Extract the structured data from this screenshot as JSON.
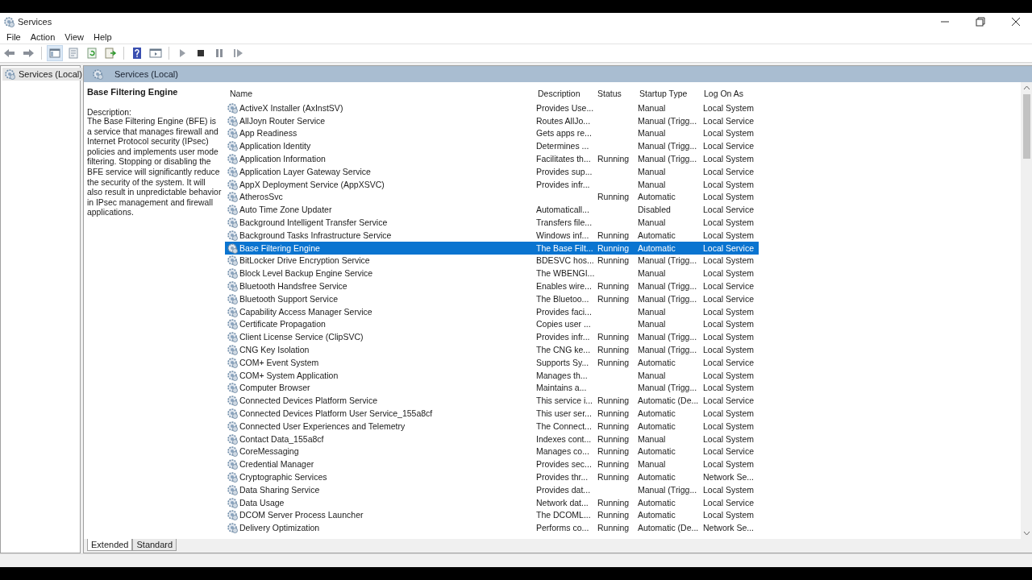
{
  "window": {
    "title": "Services"
  },
  "menu": [
    "File",
    "Action",
    "View",
    "Help"
  ],
  "toolbar": [
    {
      "kind": "back"
    },
    {
      "kind": "forward"
    },
    {
      "kind": "sep"
    },
    {
      "kind": "tree",
      "selected": true
    },
    {
      "kind": "props",
      "selected": false
    },
    {
      "kind": "refresh",
      "selected": false
    },
    {
      "kind": "export",
      "selected": false
    },
    {
      "kind": "sep"
    },
    {
      "kind": "help",
      "selected": false
    },
    {
      "kind": "view",
      "selected": false
    },
    {
      "kind": "sep"
    },
    {
      "kind": "play"
    },
    {
      "kind": "stop"
    },
    {
      "kind": "pause"
    },
    {
      "kind": "resume"
    }
  ],
  "tree": {
    "items": [
      {
        "label": "Services (Local)",
        "selected": true
      }
    ]
  },
  "panel": {
    "title": "Services (Local)"
  },
  "details": {
    "title": "Base Filtering Engine",
    "description_label": "Description:",
    "description": "The Base Filtering Engine (BFE) is a service that manages firewall and Internet Protocol security (IPsec) policies and implements user mode filtering. Stopping or disabling the BFE service will significantly reduce the security of the system. It will also result in unpredictable behavior in IPsec management and firewall applications."
  },
  "table": {
    "columns": [
      "Name",
      "Description",
      "Status",
      "Startup Type",
      "Log On As"
    ],
    "rows": [
      {
        "name": "ActiveX Installer (AxInstSV)",
        "description": "Provides Use...",
        "startup_type": "Manual",
        "log_on_as": "Local System",
        "selected": false
      },
      {
        "name": "AllJoyn Router Service",
        "description": "Routes AllJo...",
        "startup_type": "Manual (Trigg...",
        "log_on_as": "Local Service",
        "selected": false
      },
      {
        "name": "App Readiness",
        "description": "Gets apps re...",
        "startup_type": "Manual",
        "log_on_as": "Local System",
        "selected": false
      },
      {
        "name": "Application Identity",
        "description": "Determines ...",
        "startup_type": "Manual (Trigg...",
        "log_on_as": "Local Service",
        "selected": false
      },
      {
        "name": "Application Information",
        "description": "Facilitates th...",
        "status": "Running",
        "startup_type": "Manual (Trigg...",
        "log_on_as": "Local System",
        "selected": false
      },
      {
        "name": "Application Layer Gateway Service",
        "description": "Provides sup...",
        "startup_type": "Manual",
        "log_on_as": "Local Service",
        "selected": false
      },
      {
        "name": "AppX Deployment Service (AppXSVC)",
        "description": "Provides infr...",
        "startup_type": "Manual",
        "log_on_as": "Local System",
        "selected": false
      },
      {
        "name": "AtherosSvc",
        "status": "Running",
        "startup_type": "Automatic",
        "log_on_as": "Local System",
        "selected": false
      },
      {
        "name": "Auto Time Zone Updater",
        "description": "Automaticall...",
        "startup_type": "Disabled",
        "log_on_as": "Local Service",
        "selected": false
      },
      {
        "name": "Background Intelligent Transfer Service",
        "description": "Transfers file...",
        "startup_type": "Manual",
        "log_on_as": "Local System",
        "selected": false
      },
      {
        "name": "Background Tasks Infrastructure Service",
        "description": "Windows inf...",
        "status": "Running",
        "startup_type": "Automatic",
        "log_on_as": "Local System",
        "selected": false
      },
      {
        "name": "Base Filtering Engine",
        "description": "The Base Filt...",
        "status": "Running",
        "startup_type": "Automatic",
        "log_on_as": "Local Service",
        "selected": true
      },
      {
        "name": "BitLocker Drive Encryption Service",
        "description": "BDESVC hos...",
        "status": "Running",
        "startup_type": "Manual (Trigg...",
        "log_on_as": "Local System",
        "selected": false
      },
      {
        "name": "Block Level Backup Engine Service",
        "description": "The WBENGI...",
        "startup_type": "Manual",
        "log_on_as": "Local System",
        "selected": false
      },
      {
        "name": "Bluetooth Handsfree Service",
        "description": "Enables wire...",
        "status": "Running",
        "startup_type": "Manual (Trigg...",
        "log_on_as": "Local Service",
        "selected": false
      },
      {
        "name": "Bluetooth Support Service",
        "description": "The Bluetoo...",
        "status": "Running",
        "startup_type": "Manual (Trigg...",
        "log_on_as": "Local Service",
        "selected": false
      },
      {
        "name": "Capability Access Manager Service",
        "description": "Provides faci...",
        "startup_type": "Manual",
        "log_on_as": "Local System",
        "selected": false
      },
      {
        "name": "Certificate Propagation",
        "description": "Copies user ...",
        "startup_type": "Manual",
        "log_on_as": "Local System",
        "selected": false
      },
      {
        "name": "Client License Service (ClipSVC)",
        "description": "Provides infr...",
        "status": "Running",
        "startup_type": "Manual (Trigg...",
        "log_on_as": "Local System",
        "selected": false
      },
      {
        "name": "CNG Key Isolation",
        "description": "The CNG ke...",
        "status": "Running",
        "startup_type": "Manual (Trigg...",
        "log_on_as": "Local System",
        "selected": false
      },
      {
        "name": "COM+ Event System",
        "description": "Supports Sy...",
        "status": "Running",
        "startup_type": "Automatic",
        "log_on_as": "Local Service",
        "selected": false
      },
      {
        "name": "COM+ System Application",
        "description": "Manages th...",
        "startup_type": "Manual",
        "log_on_as": "Local System",
        "selected": false
      },
      {
        "name": "Computer Browser",
        "description": "Maintains a...",
        "startup_type": "Manual (Trigg...",
        "log_on_as": "Local System",
        "selected": false
      },
      {
        "name": "Connected Devices Platform Service",
        "description": "This service i...",
        "status": "Running",
        "startup_type": "Automatic (De...",
        "log_on_as": "Local Service",
        "selected": false
      },
      {
        "name": "Connected Devices Platform User Service_155a8cf",
        "description": "This user ser...",
        "status": "Running",
        "startup_type": "Automatic",
        "log_on_as": "Local System",
        "selected": false
      },
      {
        "name": "Connected User Experiences and Telemetry",
        "description": "The Connect...",
        "status": "Running",
        "startup_type": "Automatic",
        "log_on_as": "Local System",
        "selected": false
      },
      {
        "name": "Contact Data_155a8cf",
        "description": "Indexes cont...",
        "status": "Running",
        "startup_type": "Manual",
        "log_on_as": "Local System",
        "selected": false
      },
      {
        "name": "CoreMessaging",
        "description": "Manages co...",
        "status": "Running",
        "startup_type": "Automatic",
        "log_on_as": "Local Service",
        "selected": false
      },
      {
        "name": "Credential Manager",
        "description": "Provides sec...",
        "status": "Running",
        "startup_type": "Manual",
        "log_on_as": "Local System",
        "selected": false
      },
      {
        "name": "Cryptographic Services",
        "description": "Provides thr...",
        "status": "Running",
        "startup_type": "Automatic",
        "log_on_as": "Network Se...",
        "selected": false
      },
      {
        "name": "Data Sharing Service",
        "description": "Provides dat...",
        "startup_type": "Manual (Trigg...",
        "log_on_as": "Local System",
        "selected": false
      },
      {
        "name": "Data Usage",
        "description": "Network dat...",
        "status": "Running",
        "startup_type": "Automatic",
        "log_on_as": "Local Service",
        "selected": false
      },
      {
        "name": "DCOM Server Process Launcher",
        "description": "The DCOML...",
        "status": "Running",
        "startup_type": "Automatic",
        "log_on_as": "Local System",
        "selected": false
      },
      {
        "name": "Delivery Optimization",
        "description": "Performs co...",
        "status": "Running",
        "startup_type": "Automatic (De...",
        "log_on_as": "Network Se...",
        "selected": false
      }
    ]
  },
  "tabs": [
    {
      "label": "Extended",
      "selected": true
    },
    {
      "label": "Standard",
      "selected": false
    }
  ]
}
